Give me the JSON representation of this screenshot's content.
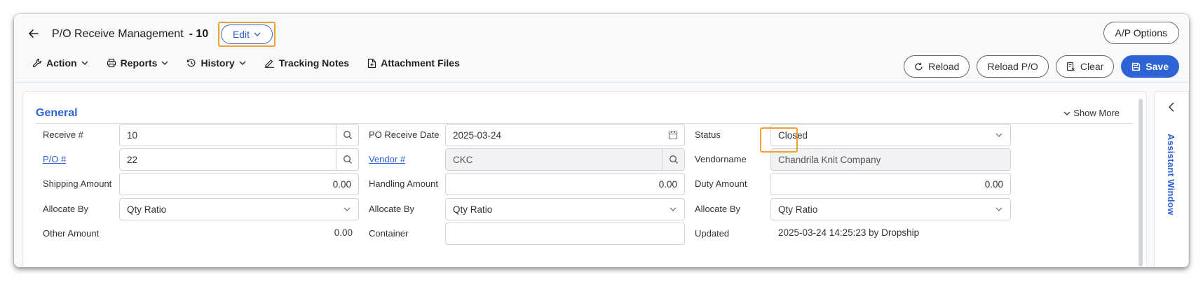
{
  "header": {
    "title": "P/O Receive Management",
    "number": "- 10",
    "edit_label": "Edit",
    "ap_options_label": "A/P Options"
  },
  "menu": {
    "action": "Action",
    "reports": "Reports",
    "history": "History",
    "tracking_notes": "Tracking Notes",
    "attachment_files": "Attachment Files"
  },
  "buttons": {
    "reload": "Reload",
    "reload_po": "Reload P/O",
    "clear": "Clear",
    "save": "Save"
  },
  "general": {
    "title": "General",
    "show_more": "Show More",
    "col1": {
      "receive_label": "Receive #",
      "receive_value": "10",
      "po_label": "P/O #",
      "po_value": "22",
      "shipping_label": "Shipping Amount",
      "shipping_value": "0.00",
      "allocate_label": "Allocate By",
      "allocate_value": "Qty Ratio",
      "other_label": "Other Amount",
      "other_value": "0.00"
    },
    "col2": {
      "date_label": "PO Receive Date",
      "date_value": "2025-03-24",
      "vendor_label": "Vendor #",
      "vendor_value": "CKC",
      "handling_label": "Handling Amount",
      "handling_value": "0.00",
      "allocate_label": "Allocate By",
      "allocate_value": "Qty Ratio",
      "container_label": "Container",
      "container_value": ""
    },
    "col3": {
      "status_label": "Status",
      "status_value": "Closed",
      "vendorname_label": "Vendorname",
      "vendorname_value": "Chandrila Knit Company",
      "duty_label": "Duty Amount",
      "duty_value": "0.00",
      "allocate_label": "Allocate By",
      "allocate_value": "Qty Ratio",
      "updated_label": "Updated",
      "updated_value": "2025-03-24 14:25:23 by Dropship"
    }
  },
  "assistant": {
    "label": "Assistant Window"
  },
  "colors": {
    "accent": "#2e63d6",
    "highlight": "#f0a030"
  }
}
